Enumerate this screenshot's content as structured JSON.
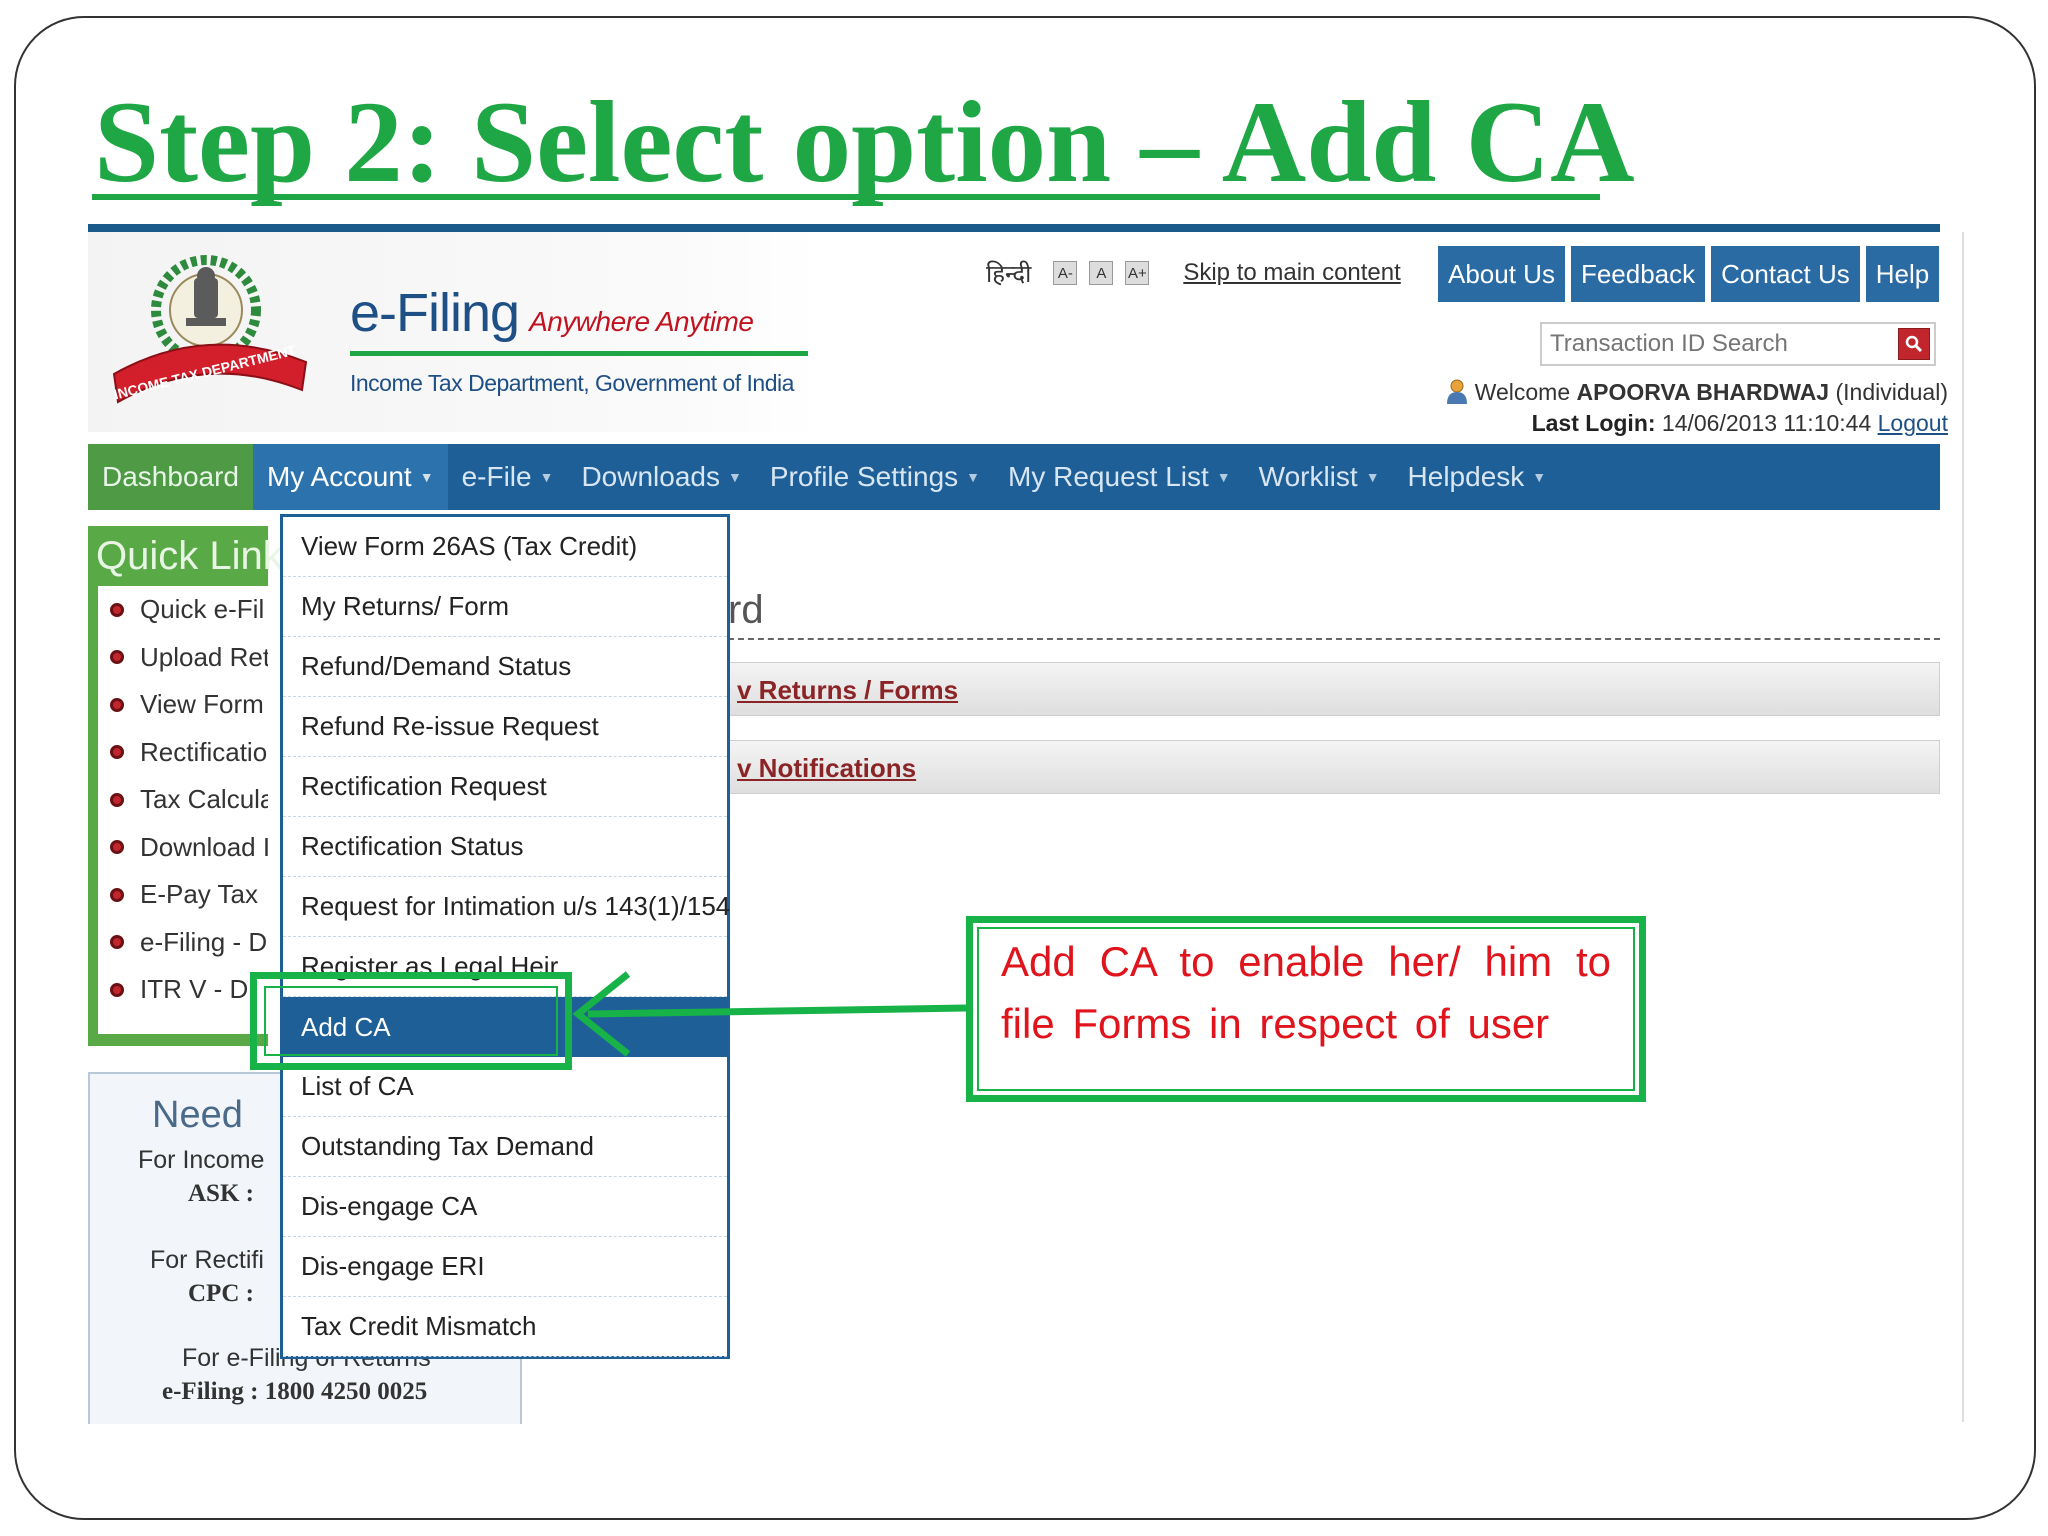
{
  "slide": {
    "title": "Step 2: Select option – Add CA"
  },
  "header": {
    "brand_name": "e-Filing",
    "brand_tagline": "Anywhere Anytime",
    "brand_subtitle": "Income Tax Department, Government of India",
    "hindi_link": "हिन्दी",
    "font_controls": [
      "A-",
      "A",
      "A+"
    ],
    "skip_link": "Skip to main content",
    "top_tabs": [
      "About Us",
      "Feedback",
      "Contact Us",
      "Help"
    ],
    "search_placeholder": "Transaction ID Search",
    "welcome_prefix": "Welcome",
    "user_name": "APOORVA BHARDWAJ",
    "user_type": "(Individual)",
    "last_login_label": "Last Login:",
    "last_login_value": "14/06/2013 11:10:44",
    "logout_label": "Logout"
  },
  "nav": {
    "items": [
      "Dashboard",
      "My Account",
      "e-File",
      "Downloads",
      "Profile Settings",
      "My Request List",
      "Worklist",
      "Helpdesk"
    ],
    "active": "Dashboard",
    "open_menu": "My Account"
  },
  "quick_links": {
    "title": "Quick Link",
    "items": [
      "Quick e-Fil",
      "Upload Ret",
      "View Form",
      "Rectificatio",
      "Tax Calcula",
      "Download I",
      "E-Pay Tax",
      "e-Filing - D",
      "ITR V - D"
    ]
  },
  "need_help": {
    "title": "Need",
    "line1": "For Income",
    "ask_label": "ASK :",
    "line2": "For Rectifi",
    "cpc_label": "CPC :",
    "line3": "For e-Filing of Returns",
    "efiling_phone": "e-Filing : 1800 4250 0025"
  },
  "content": {
    "heading_stub": "rd",
    "bar1": "v Returns / Forms",
    "bar2": "v Notifications"
  },
  "dropdown": {
    "items": [
      "View Form 26AS (Tax Credit)",
      "My Returns/ Form",
      "Refund/Demand Status",
      "Refund Re-issue Request",
      "Rectification Request",
      "Rectification Status",
      "Request for Intimation u/s 143(1)/154",
      "Register as Legal Heir",
      "Add CA",
      "List of CA",
      "Outstanding Tax Demand",
      "Dis-engage CA",
      "Dis-engage ERI",
      "Tax Credit Mismatch"
    ],
    "selected": "Add CA"
  },
  "callout": {
    "text": "Add CA to enable her/ him to file Forms in respect of user"
  },
  "colors": {
    "title_green": "#1fa746",
    "nav_blue": "#1e5f98",
    "highlight_green": "#17b248",
    "callout_red": "#e0141c"
  },
  "icons": {
    "emblem": "income-tax-emblem",
    "search": "search-icon",
    "user": "user-icon",
    "bullet": "bullet-icon",
    "arrow": "arrow-left"
  }
}
